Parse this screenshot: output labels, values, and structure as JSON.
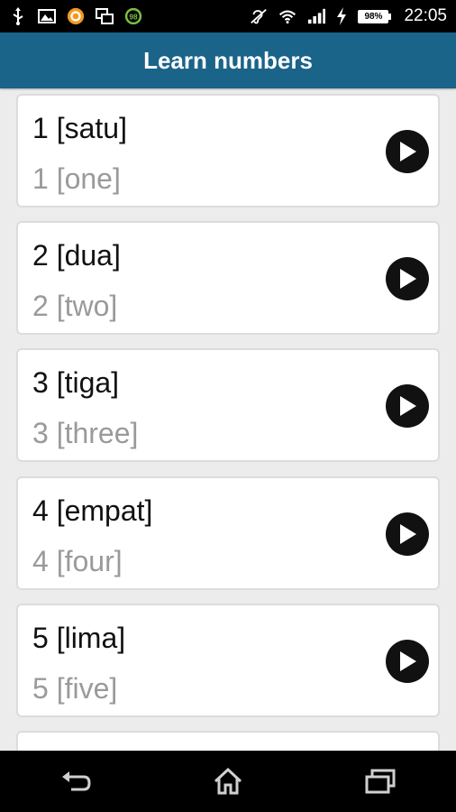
{
  "status_bar": {
    "time": "22:05",
    "battery_percent": 98,
    "battery_label": "98%",
    "notification_badge": "98",
    "icons_left": [
      "usb-icon",
      "image-icon",
      "orange-app-icon",
      "multiwindow-icon",
      "badge-98-icon"
    ],
    "icons_right": [
      "hearing-aid-icon",
      "wifi-icon",
      "signal-icon",
      "charging-icon",
      "battery-icon"
    ]
  },
  "app_bar": {
    "title": "Learn numbers",
    "color": "#1a6389"
  },
  "items": [
    {
      "primary": "1 [satu]",
      "secondary": "1 [one]"
    },
    {
      "primary": "2 [dua]",
      "secondary": "2 [two]"
    },
    {
      "primary": "3 [tiga]",
      "secondary": "3 [three]"
    },
    {
      "primary": "4 [empat]",
      "secondary": "4 [four]"
    },
    {
      "primary": "5 [lima]",
      "secondary": "5 [five]"
    }
  ],
  "nav_bar": {
    "icons": [
      "back-icon",
      "home-icon",
      "recent-apps-icon"
    ]
  }
}
